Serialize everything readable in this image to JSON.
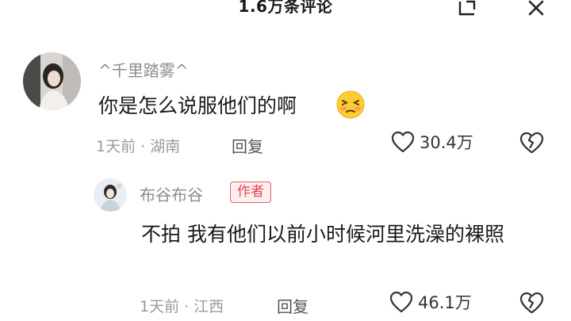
{
  "header": {
    "title": "1.6万条评论",
    "expand_icon": "expand-icon",
    "close_icon": "close-icon"
  },
  "comment": {
    "username": "^千里踏雾^",
    "text": "你是怎么说服他们的啊",
    "emoji": "embarrassed-face-emoji",
    "meta": "1天前 · 湖南",
    "reply_label": "回复",
    "like_count": "30.4万"
  },
  "reply": {
    "username": "布谷布谷",
    "badge": "作者",
    "text": "不拍 我有他们以前小时候河里洗澡的裸照",
    "meta": "1天前 · 江西",
    "reply_label": "回复",
    "like_count": "46.1万"
  },
  "colors": {
    "badge_border": "#e8606a",
    "badge_text": "#e24552",
    "meta_text": "#9a9a9a"
  }
}
